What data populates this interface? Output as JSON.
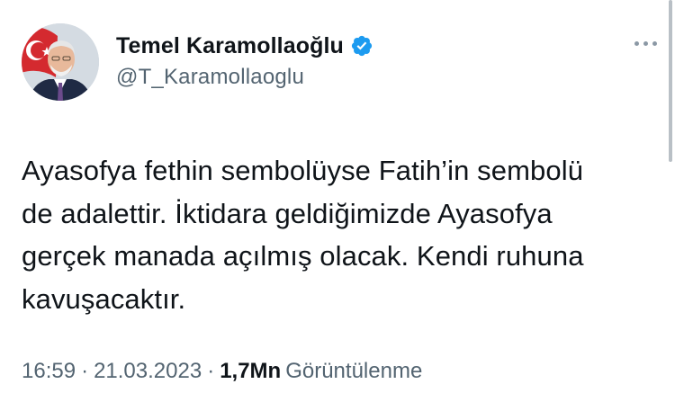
{
  "author": {
    "display_name": "Temel Karamollaoğlu",
    "handle": "@T_Karamollaoglu",
    "verified": true,
    "verified_color": "#1d9bf0"
  },
  "tweet": {
    "text": "Ayasofya fethin sembolüyse Fatih’in sembolü\nde adalettir. İktidara geldiğimizde Ayasofya\ngerçek manada açılmış olacak. Kendi ruhuna\nkavuşacaktır."
  },
  "meta": {
    "time": "16:59",
    "separator": "·",
    "date": "21.03.2023",
    "views_count": "1,7Mn",
    "views_label": "Görüntülenme"
  },
  "icons": {
    "more": "more-horizontal-icon",
    "verified": "verified-badge-icon"
  },
  "colors": {
    "text_primary": "#0f1419",
    "text_secondary": "#536471"
  }
}
